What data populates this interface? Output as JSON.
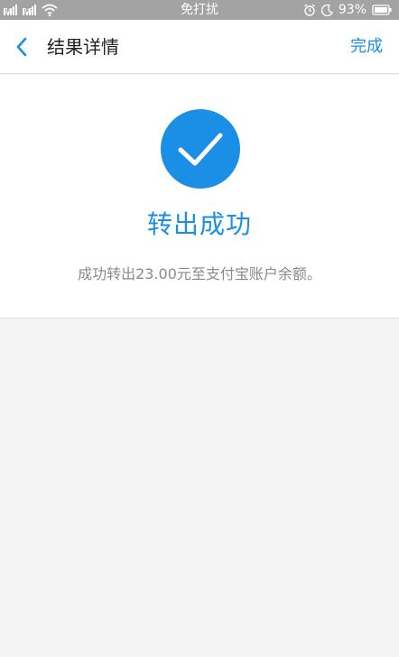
{
  "status_bar": {
    "carrier_center": "免打扰",
    "battery": "93%",
    "signal_tag": "2G"
  },
  "nav": {
    "title": "结果详情",
    "done_label": "完成"
  },
  "result": {
    "title": "转出成功",
    "description": "成功转出23.00元至支付宝账户余额。"
  },
  "colors": {
    "accent": "#1b8ee6",
    "status_bar_bg": "#a3a3a3",
    "page_bg": "#f4f4f4"
  }
}
